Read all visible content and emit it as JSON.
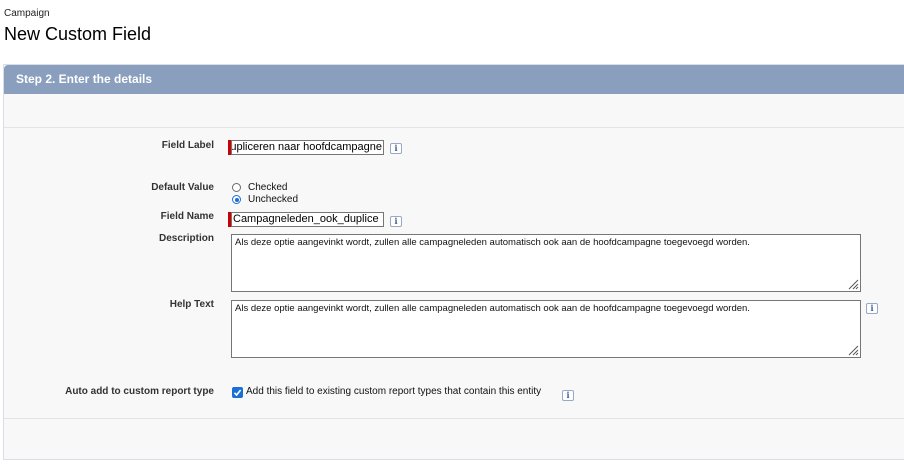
{
  "header": {
    "object_name": "Campaign",
    "title": "New Custom Field"
  },
  "step": {
    "title": "Step 2. Enter the details"
  },
  "form": {
    "field_label": {
      "label": "Field Label",
      "value": "Campagneleden ook dupliceren naar hoofdcampagne",
      "info_icon": "info-icon"
    },
    "default_value": {
      "label": "Default Value",
      "options": [
        "Checked",
        "Unchecked"
      ],
      "selected": "Unchecked"
    },
    "field_name": {
      "label": "Field Name",
      "value": "Campagneleden_ook_duplice",
      "info_icon": "info-icon"
    },
    "description": {
      "label": "Description",
      "value": "Als deze optie aangevinkt wordt, zullen alle campagneleden automatisch ook aan de hoofdcampagne toegevoegd worden."
    },
    "help_text": {
      "label": "Help Text",
      "value": "Als deze optie aangevinkt wordt, zullen alle campagneleden automatisch ook aan de hoofdcampagne toegevoegd worden.",
      "info_icon": "info-icon"
    },
    "auto_add": {
      "label": "Auto add to custom report type",
      "checkbox_label": "Add this field to existing custom report types that contain this entity",
      "checked": true,
      "info_icon": "info-icon"
    }
  },
  "colors": {
    "panel_header": "#8a9ebe",
    "required": "#cc0000",
    "accent": "#1a6fd6"
  }
}
